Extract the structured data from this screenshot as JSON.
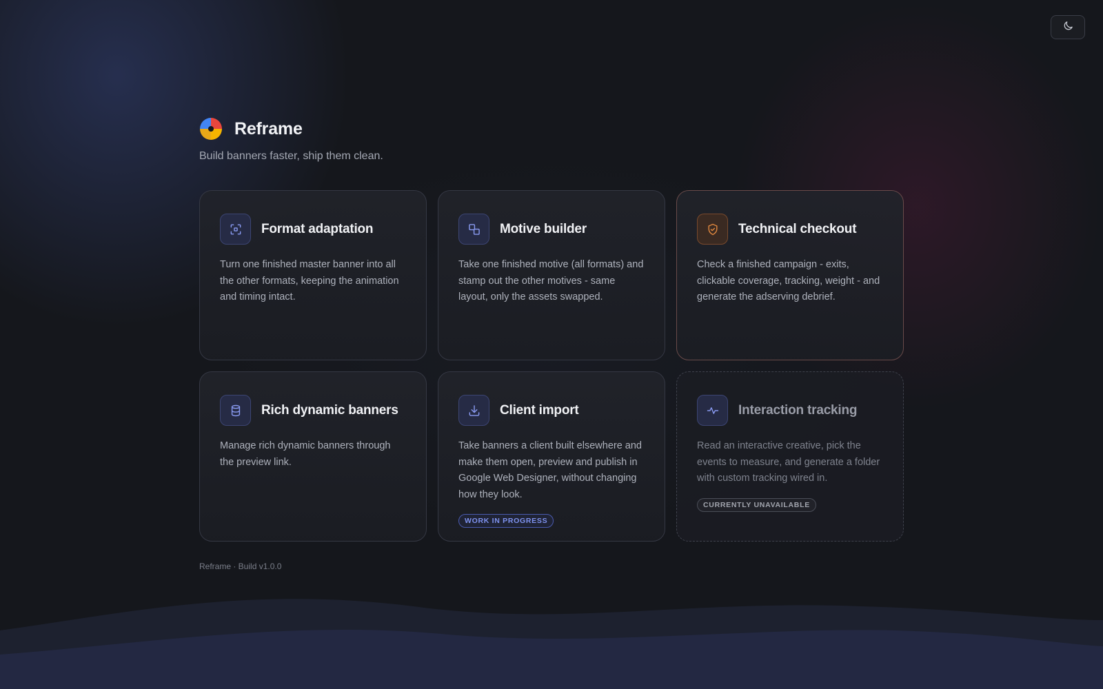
{
  "app": {
    "title": "Reframe",
    "tagline": "Build banners faster, ship them clean.",
    "logo_icon": "reframe-logo",
    "logo_colors": [
      "#e9463d",
      "#f5b400",
      "#34a853",
      "#4285f4"
    ]
  },
  "theme_toggle": {
    "icon": "moon-icon"
  },
  "colors": {
    "accent": "#7f93f0",
    "highlight_accent": "#e0883f",
    "background": "#15171c"
  },
  "cards": [
    {
      "title": "Format adaptation",
      "description": "Turn one finished master banner into all the other formats, keeping the animation and timing intact.",
      "icon": "focus-frame-icon"
    },
    {
      "title": "Motive builder",
      "description": "Take one finished motive (all formats) and stamp out the other motives - same layout, only the assets swapped.",
      "icon": "copy-shapes-icon"
    },
    {
      "title": "Technical checkout",
      "description": "Check a finished campaign - exits, clickable coverage, tracking, weight - and generate the adserving debrief.",
      "icon": "shield-check-icon"
    },
    {
      "title": "Rich dynamic banners",
      "description": "Manage rich dynamic banners through the preview link.",
      "icon": "database-icon"
    },
    {
      "title": "Client import",
      "description": "Take banners a client built elsewhere and make them open, preview and publish in Google Web Designer, without changing how they look.",
      "icon": "download-icon",
      "badge": "WORK IN PROGRESS"
    },
    {
      "title": "Interaction tracking",
      "description": "Read an interactive creative, pick the events to measure, and generate a folder with custom tracking wired in.",
      "icon": "activity-icon",
      "badge": "CURRENTLY UNAVAILABLE"
    }
  ],
  "footer": {
    "text": "Reframe · Build v1.0.0"
  }
}
